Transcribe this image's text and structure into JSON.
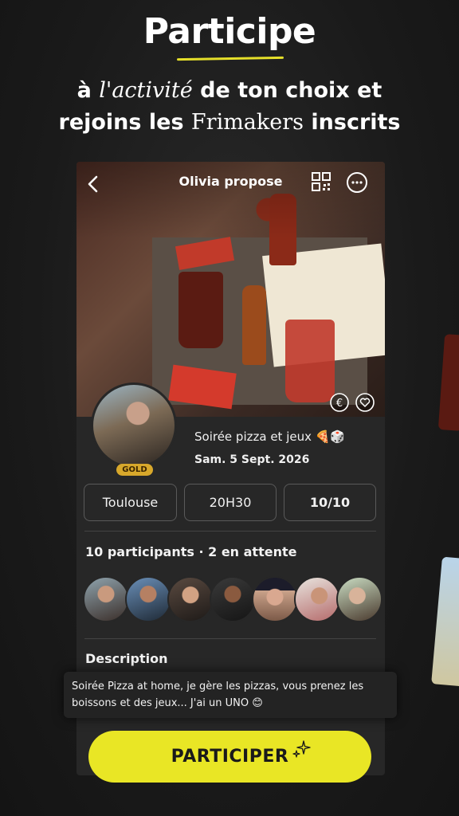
{
  "promo": {
    "headline": "Participe",
    "line1_a": "à ",
    "line1_b": "l'activité",
    "line1_c": " de ton choix et",
    "line2_a": "rejoins les ",
    "line2_b": "Frimakers",
    "line2_c": " inscrits"
  },
  "header": {
    "title": "Olivia propose",
    "icons": [
      "back-icon",
      "qr-code-icon",
      "more-icon"
    ]
  },
  "photo_actions": {
    "icons": [
      "euro-icon",
      "heart-icon"
    ]
  },
  "host": {
    "badge": "GOLD"
  },
  "event": {
    "title": "Soirée pizza et jeux 🍕🎲",
    "date": "Sam. 5 Sept. 2026",
    "city": "Toulouse",
    "time": "20H30",
    "capacity": "10/10"
  },
  "participants": {
    "title": "10 participants · 2 en attente"
  },
  "description": {
    "title": "Description",
    "text": "Soirée Pizza at home, je gère les pizzas, vous prenez les boissons et des jeux... J'ai un UNO 😊"
  },
  "cta": {
    "label": "PARTICIPER"
  },
  "colors": {
    "accent": "#e9e625",
    "gold": "#d8a82b",
    "background": "#1a1a1a",
    "panel": "#272727"
  }
}
